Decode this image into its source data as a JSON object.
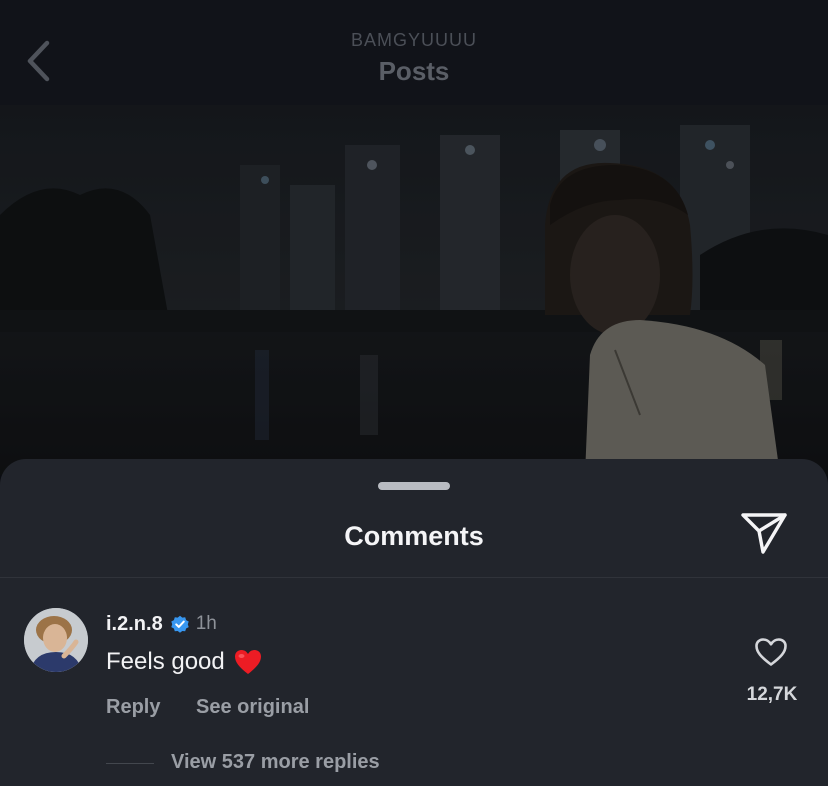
{
  "header": {
    "username": "BAMGYUUUU",
    "title": "Posts",
    "back_icon": "chevron-left-icon"
  },
  "photo": {
    "description_icon": "post-photo"
  },
  "comments_sheet": {
    "title": "Comments",
    "share_icon": "paper-plane-icon",
    "comment": {
      "username": "i.2.n.8",
      "verified": true,
      "time": "1h",
      "text": "Feels good",
      "emoji": "red-heart",
      "reply_label": "Reply",
      "see_original_label": "See original",
      "like_count": "12,7K",
      "view_replies_label": "View 537 more replies"
    }
  },
  "colors": {
    "sheet_bg": "#22252c",
    "header_bg": "#111319",
    "verified_blue": "#3897f0",
    "heart_red": "#ed1c24"
  }
}
